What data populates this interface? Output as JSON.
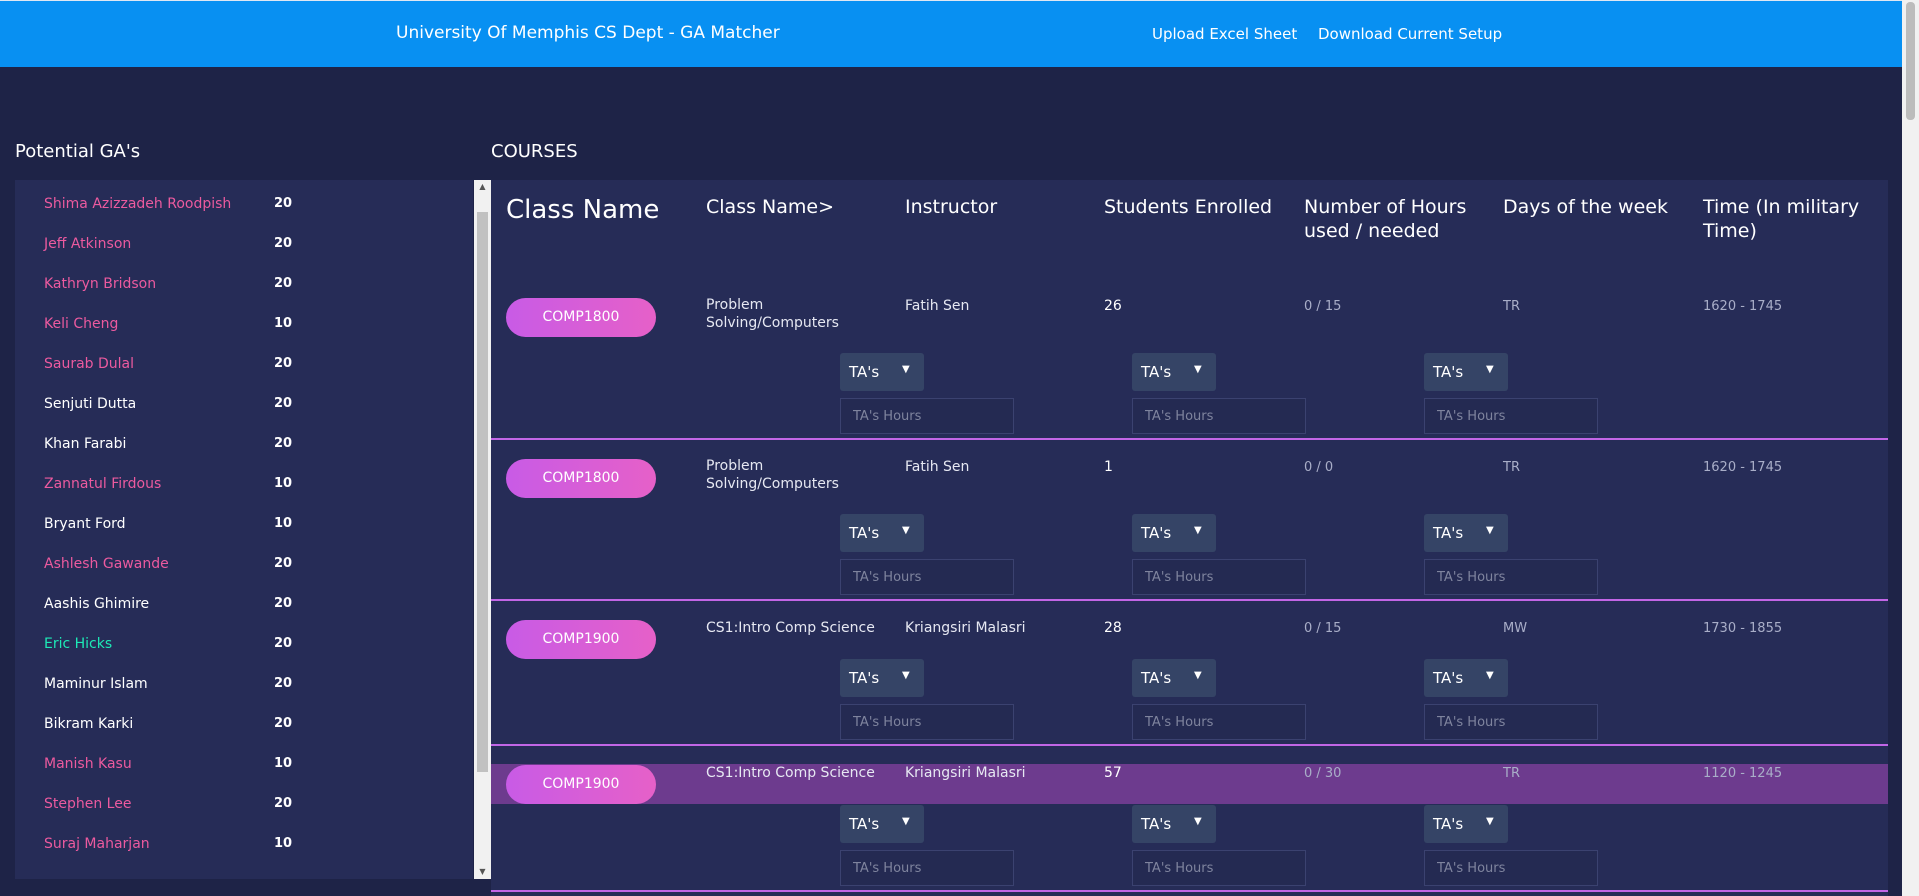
{
  "header": {
    "title": "University Of Memphis CS Dept - GA Matcher",
    "upload_label": "Upload Excel Sheet",
    "download_label": "Download Current Setup"
  },
  "ga_panel": {
    "title": "Potential GA's",
    "items": [
      {
        "name": "Shima Azizzadeh Roodpish",
        "hours": "20",
        "color": "#ec5a9f"
      },
      {
        "name": "Jeff Atkinson",
        "hours": "20",
        "color": "#ec5a9f"
      },
      {
        "name": "Kathryn Bridson",
        "hours": "20",
        "color": "#ec5a9f"
      },
      {
        "name": "Keli Cheng",
        "hours": "10",
        "color": "#ec5a9f"
      },
      {
        "name": "Saurab Dulal",
        "hours": "20",
        "color": "#ec5a9f"
      },
      {
        "name": "Senjuti Dutta",
        "hours": "20",
        "color": "#ffffff"
      },
      {
        "name": "Khan Farabi",
        "hours": "20",
        "color": "#ffffff"
      },
      {
        "name": "Zannatul Firdous",
        "hours": "10",
        "color": "#ec5a9f"
      },
      {
        "name": "Bryant Ford",
        "hours": "10",
        "color": "#ffffff"
      },
      {
        "name": "Ashlesh Gawande",
        "hours": "20",
        "color": "#ec5a9f"
      },
      {
        "name": "Aashis Ghimire",
        "hours": "20",
        "color": "#ffffff"
      },
      {
        "name": "Eric Hicks",
        "hours": "20",
        "color": "#1de9b6"
      },
      {
        "name": "Maminur Islam",
        "hours": "20",
        "color": "#ffffff"
      },
      {
        "name": "Bikram Karki",
        "hours": "20",
        "color": "#ffffff"
      },
      {
        "name": "Manish Kasu",
        "hours": "10",
        "color": "#ec5a9f"
      },
      {
        "name": "Stephen Lee",
        "hours": "20",
        "color": "#ec5a9f"
      },
      {
        "name": "Suraj Maharjan",
        "hours": "10",
        "color": "#ec5a9f"
      }
    ]
  },
  "courses_panel": {
    "title": "COURSES",
    "headers": [
      "Class Name",
      "Class Name>",
      "Instructor",
      "Students Enrolled",
      "Number of Hours used / needed",
      "Days of the week",
      "Time (In military Time)"
    ],
    "ta_select_label": "TA's",
    "ta_hours_placeholder": "TA's Hours",
    "courses": [
      {
        "code": "COMP1800",
        "name": "Problem Solving/Computers",
        "instructor": "Fatih Sen",
        "enrolled": "26",
        "hours": "0 / 15",
        "days": "TR",
        "time": "1620 - 1745"
      },
      {
        "code": "COMP1800",
        "name": "Problem Solving/Computers",
        "instructor": "Fatih Sen",
        "enrolled": "1",
        "hours": "0 / 0",
        "days": "TR",
        "time": "1620 - 1745"
      },
      {
        "code": "COMP1900",
        "name": "CS1:Intro Comp Science",
        "instructor": "Kriangsiri Malasri",
        "enrolled": "28",
        "hours": "0 / 15",
        "days": "MW",
        "time": "1730 - 1855"
      },
      {
        "code": "COMP1900",
        "name": "CS1:Intro Comp Science",
        "instructor": "Kriangsiri Malasri",
        "enrolled": "57",
        "hours": "0 / 30",
        "days": "TR",
        "time": "1120 - 1245"
      }
    ]
  },
  "colors": {
    "header_bg": "#0890f2",
    "page_bg": "#1e2347",
    "panel_bg": "#262c57",
    "accent_pink": "#ec5a9f",
    "highlight_row": "#6d3b8e",
    "button_gradient_start": "#c85be6",
    "button_gradient_end": "#e660c8"
  }
}
